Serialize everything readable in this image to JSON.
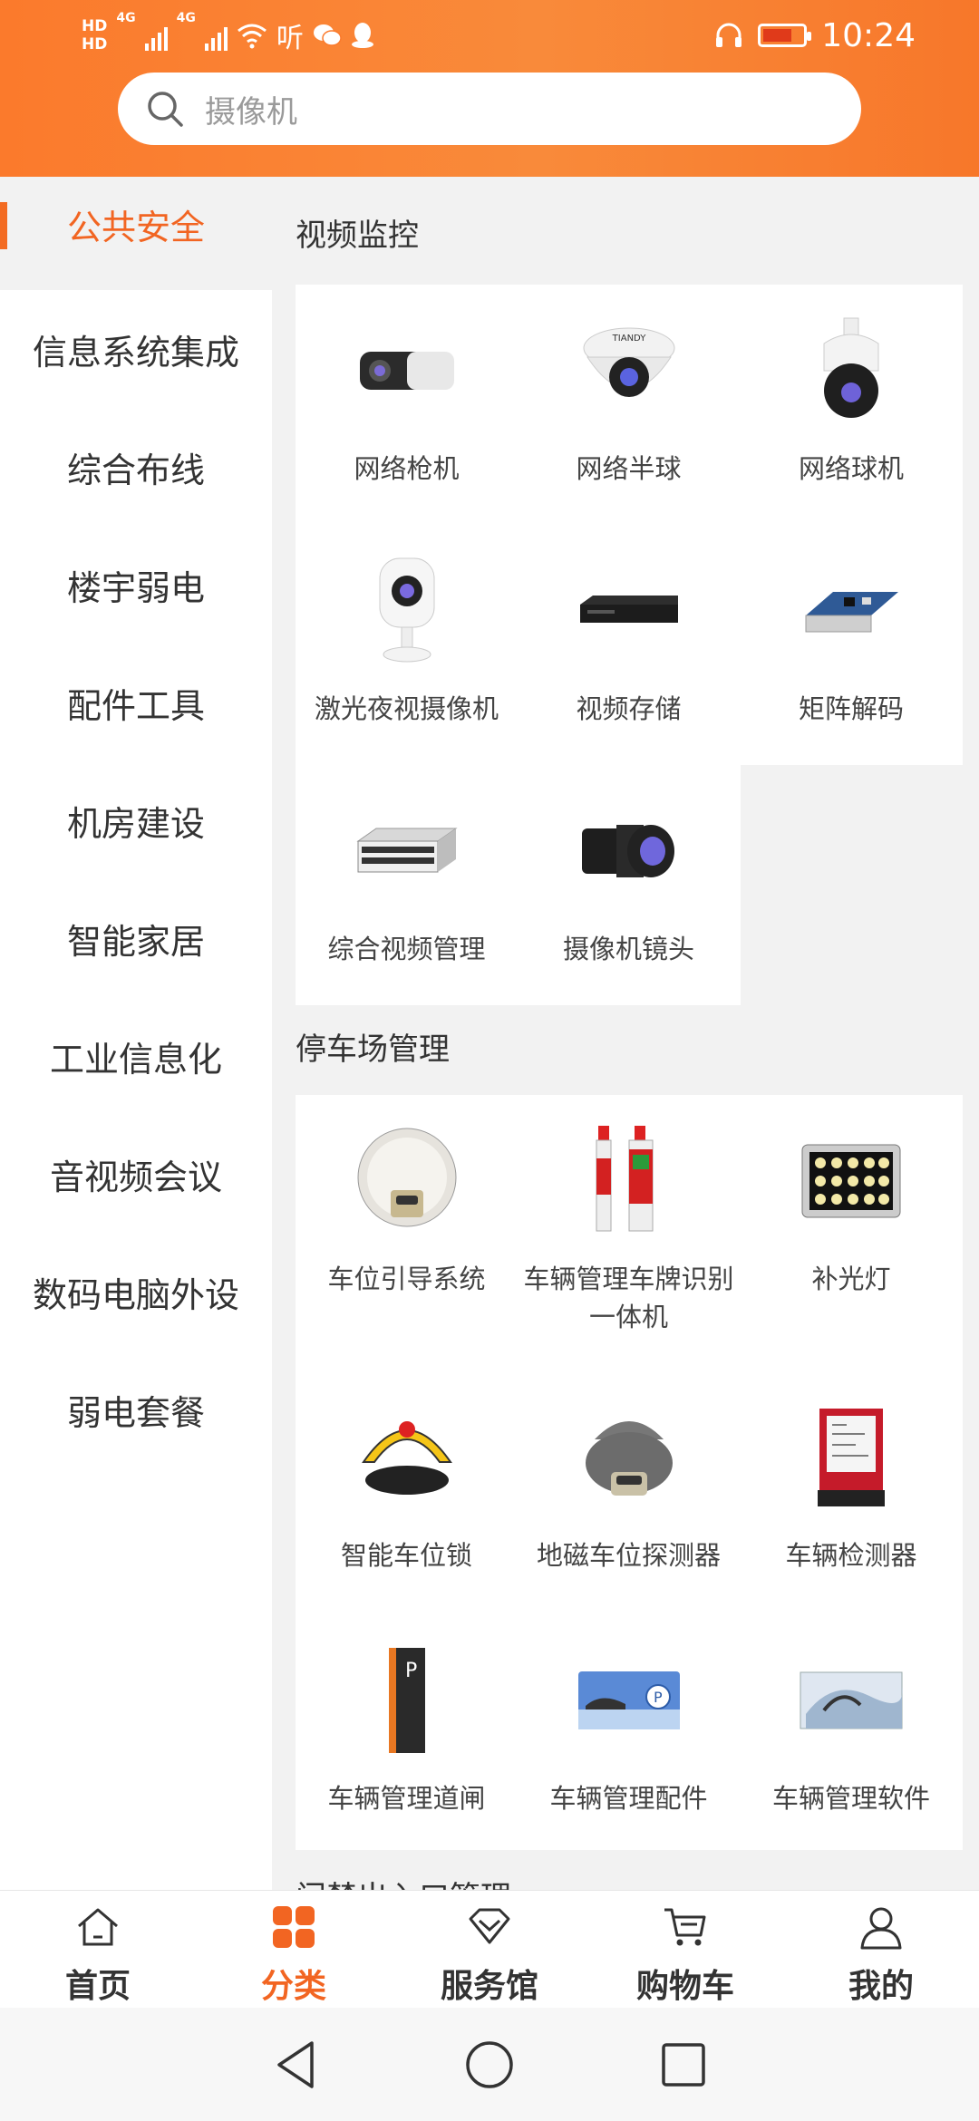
{
  "status": {
    "time": "10:24",
    "hd1": "HD",
    "hd2": "HD",
    "net1": "4G",
    "net2": "4G",
    "speed": "听"
  },
  "search": {
    "placeholder": "摄像机"
  },
  "sidebar": {
    "active": "公共安全",
    "items": [
      "信息系统集成",
      "综合布线",
      "楼宇弱电",
      "配件工具",
      "机房建设",
      "智能家居",
      "工业信息化",
      "音视频会议",
      "数码电脑外设",
      "弱电套餐"
    ]
  },
  "sections": [
    {
      "title": "视频监控",
      "items": [
        {
          "name": "网络枪机",
          "icon": "bullet-camera-icon"
        },
        {
          "name": "网络半球",
          "icon": "dome-camera-icon"
        },
        {
          "name": "网络球机",
          "icon": "ptz-camera-icon"
        },
        {
          "name": "激光夜视摄像机",
          "icon": "night-vision-camera-icon"
        },
        {
          "name": "视频存储",
          "icon": "nvr-icon"
        },
        {
          "name": "矩阵解码",
          "icon": "decoder-board-icon"
        },
        {
          "name": "综合视频管理",
          "icon": "server-rack-icon"
        },
        {
          "name": "摄像机镜头",
          "icon": "camera-lens-icon"
        }
      ]
    },
    {
      "title": "停车场管理",
      "items": [
        {
          "name": "车位引导系统",
          "icon": "parking-guide-sensor-icon"
        },
        {
          "name": "车辆管理车牌识别一体机",
          "icon": "plate-recognition-icon"
        },
        {
          "name": "补光灯",
          "icon": "fill-light-icon"
        },
        {
          "name": "智能车位锁",
          "icon": "parking-lock-icon"
        },
        {
          "name": "地磁车位探测器",
          "icon": "magnetic-detector-icon"
        },
        {
          "name": "车辆检测器",
          "icon": "vehicle-detector-icon"
        },
        {
          "name": "车辆管理道闸",
          "icon": "barrier-gate-icon"
        },
        {
          "name": "车辆管理配件",
          "icon": "parking-card-icon"
        },
        {
          "name": "车辆管理软件",
          "icon": "parking-software-icon"
        }
      ]
    },
    {
      "title": "门禁出入口管理"
    }
  ],
  "bottom_nav": {
    "home": "首页",
    "category": "分类",
    "service": "服务馆",
    "cart": "购物车",
    "mine": "我的"
  },
  "colors": {
    "accent": "#f26522",
    "header": "#fb7a2c"
  }
}
